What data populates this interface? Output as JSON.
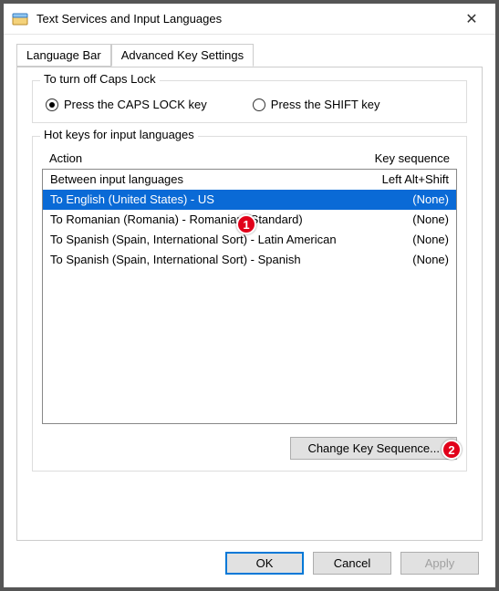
{
  "window": {
    "title": "Text Services and Input Languages"
  },
  "tabs": {
    "language_bar": "Language Bar",
    "advanced": "Advanced Key Settings"
  },
  "caps_group": {
    "title": "To turn off Caps Lock",
    "opt_caps": "Press the CAPS LOCK key",
    "opt_shift": "Press the SHIFT key"
  },
  "hotkeys_group": {
    "title": "Hot keys for input languages",
    "col_action": "Action",
    "col_key": "Key sequence",
    "rows": [
      {
        "action": "Between input languages",
        "key": "Left Alt+Shift",
        "selected": false
      },
      {
        "action": "To English (United States) - US",
        "key": "(None)",
        "selected": true
      },
      {
        "action": "To Romanian (Romania) - Romanian (Standard)",
        "key": "(None)",
        "selected": false
      },
      {
        "action": "To Spanish (Spain, International Sort) - Latin American",
        "key": "(None)",
        "selected": false
      },
      {
        "action": "To Spanish (Spain, International Sort) - Spanish",
        "key": "(None)",
        "selected": false
      }
    ],
    "change_btn": "Change Key Sequence..."
  },
  "buttons": {
    "ok": "OK",
    "cancel": "Cancel",
    "apply": "Apply"
  },
  "badges": {
    "one": "1",
    "two": "2"
  }
}
